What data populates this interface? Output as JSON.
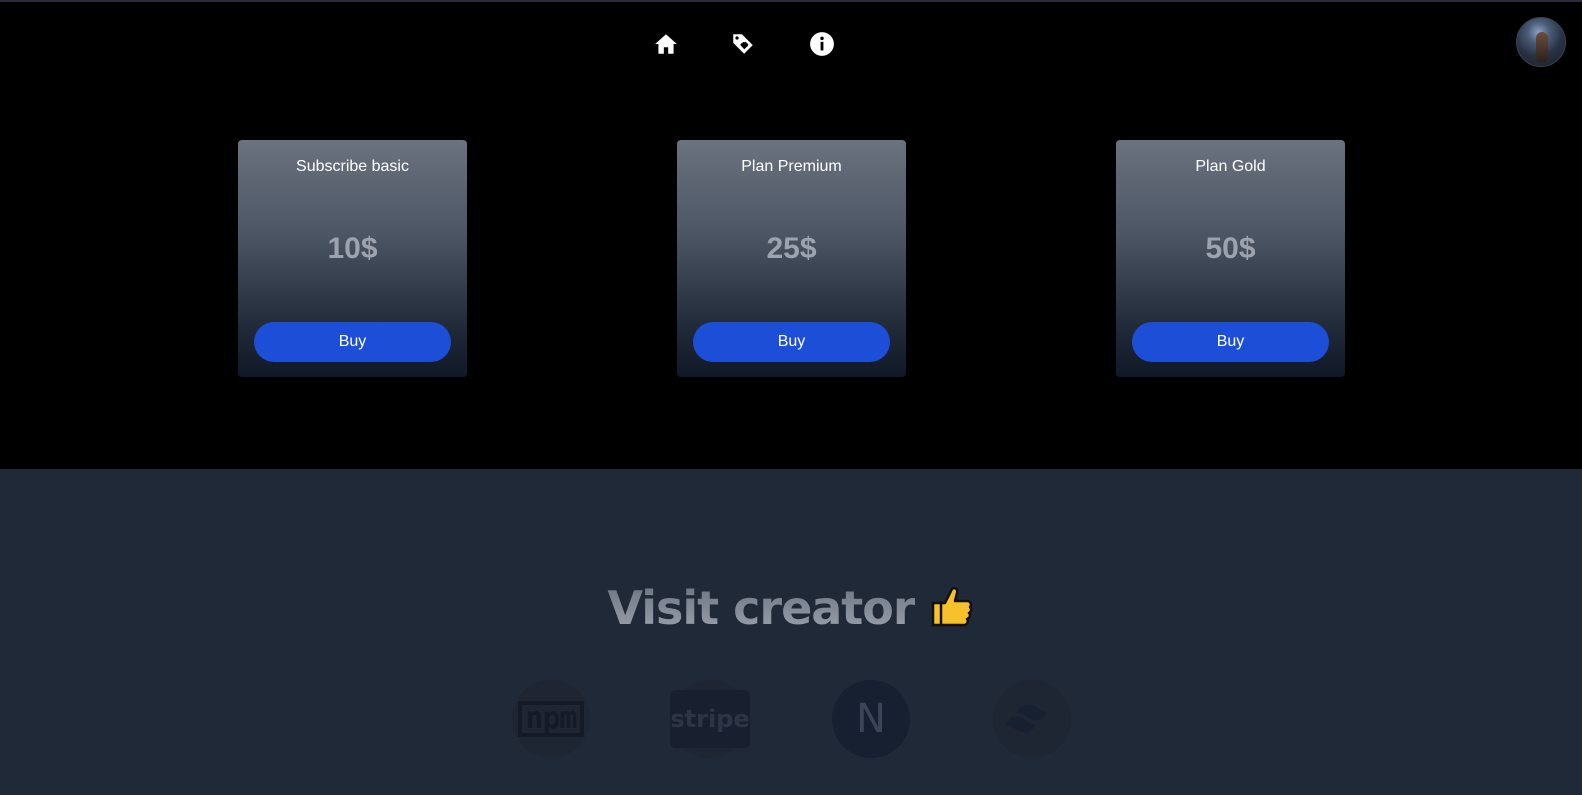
{
  "nav": {
    "icons": [
      "home-icon",
      "tag-heart-icon",
      "info-icon"
    ]
  },
  "plans": [
    {
      "title": "Subscribe basic",
      "price": "10$",
      "button": "Buy"
    },
    {
      "title": "Plan Premium",
      "price": "25$",
      "button": "Buy"
    },
    {
      "title": "Plan Gold",
      "price": "50$",
      "button": "Buy"
    }
  ],
  "footer": {
    "heading": "Visit creator",
    "emoji": "thumbs-up-icon",
    "logos": [
      "npm",
      "stripe",
      "N",
      "tailwind-icon"
    ]
  },
  "colors": {
    "button": "#1d4ed8",
    "footer_bg": "#202938",
    "price": "#9ca3af"
  }
}
